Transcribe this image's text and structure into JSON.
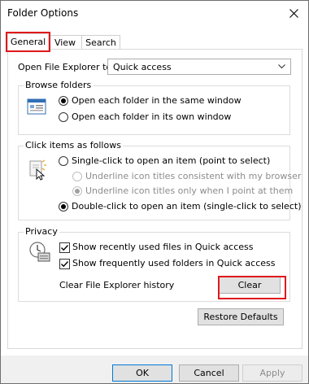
{
  "window": {
    "title": "Folder Options"
  },
  "tabs": [
    {
      "label": "General",
      "active": true
    },
    {
      "label": "View",
      "active": false
    },
    {
      "label": "Search",
      "active": false
    }
  ],
  "general": {
    "open_label": "Open File Explorer to:",
    "open_value": "Quick access",
    "browse": {
      "title": "Browse folders",
      "options": [
        {
          "label": "Open each folder in the same window",
          "selected": true
        },
        {
          "label": "Open each folder in its own window",
          "selected": false
        }
      ]
    },
    "click": {
      "title": "Click items as follows",
      "single": {
        "label": "Single-click to open an item (point to select)",
        "selected": false
      },
      "underline_consistent": {
        "label": "Underline icon titles consistent with my browser",
        "selected": false,
        "disabled": true
      },
      "underline_point": {
        "label": "Underline icon titles only when I point at them",
        "selected": true,
        "disabled": true
      },
      "double": {
        "label": "Double-click to open an item (single-click to select)",
        "selected": true
      }
    },
    "privacy": {
      "title": "Privacy",
      "show_recent_files": {
        "label": "Show recently used files in Quick access",
        "checked": true
      },
      "show_frequent_folders": {
        "label": "Show frequently used folders in Quick access",
        "checked": true
      },
      "clear_history_label": "Clear File Explorer history",
      "clear_button": "Clear"
    },
    "restore_button": "Restore Defaults"
  },
  "footer": {
    "ok": "OK",
    "cancel": "Cancel",
    "apply": "Apply"
  },
  "colors": {
    "highlight": "#e0181b",
    "accent": "#0078d7"
  }
}
